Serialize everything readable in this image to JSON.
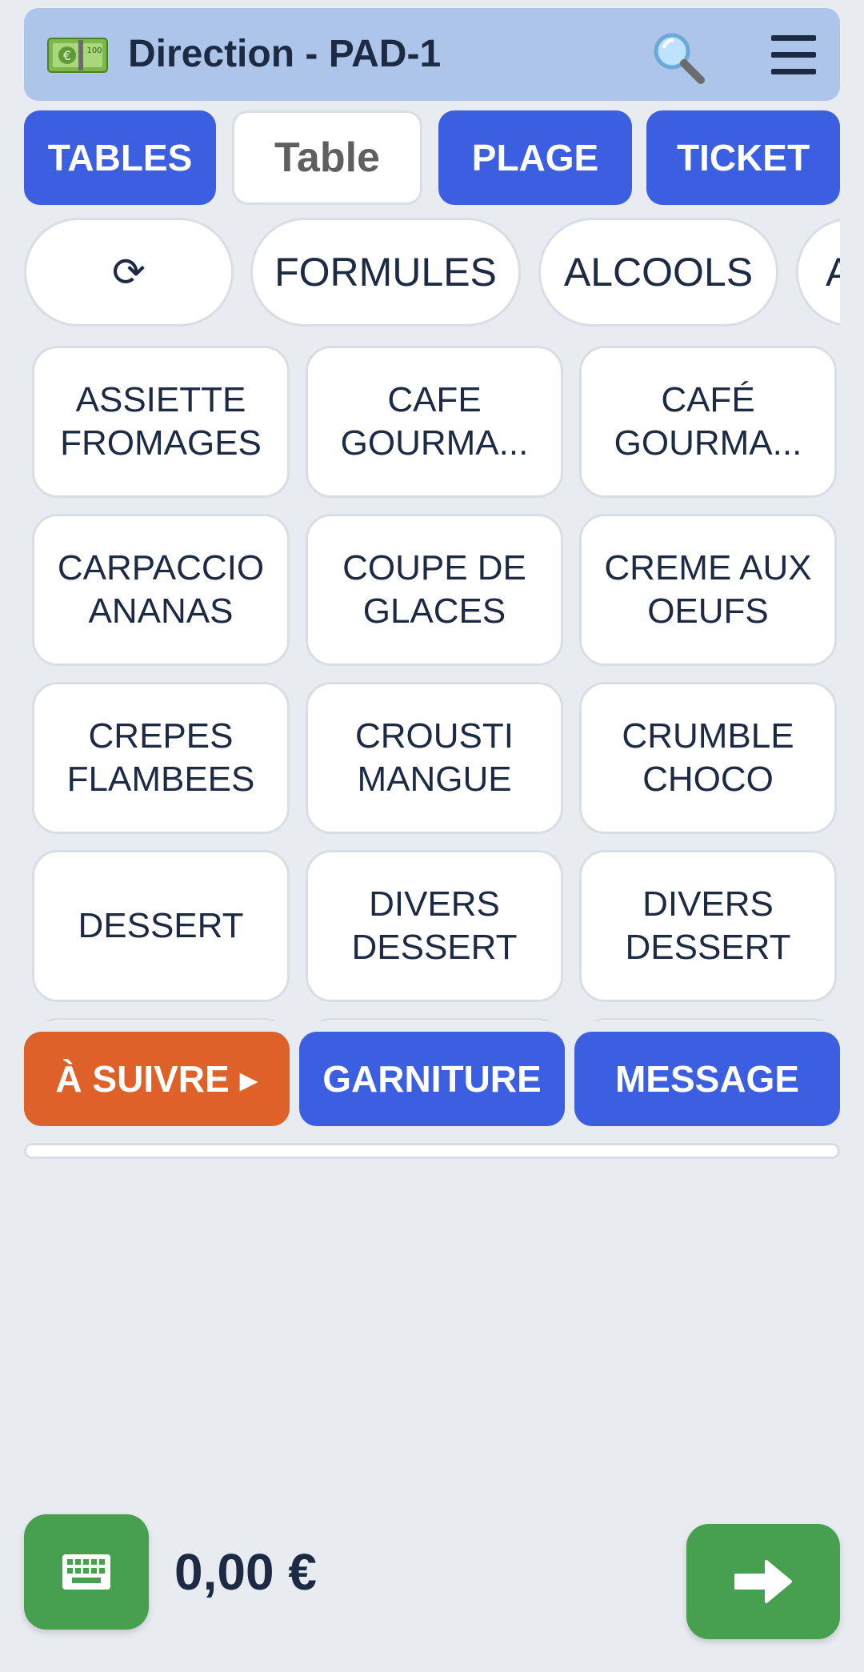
{
  "header": {
    "title": "Direction - PAD-1",
    "logo_icon": "money-bill-icon",
    "search_icon": "search-icon",
    "menu_icon": "hamburger-menu-icon"
  },
  "nav": {
    "tables": "TABLES",
    "table": "Table",
    "plage": "PLAGE",
    "ticket": "TICKET"
  },
  "categories": {
    "refresh_icon": "refresh-icon",
    "items": [
      "⟳",
      "FORMULES",
      "ALCOOLS",
      "A"
    ]
  },
  "products": [
    [
      "ASSIETTE",
      "FROMAGES"
    ],
    [
      "CAFE",
      "GOURMA..."
    ],
    [
      "CAFÉ",
      "GOURMA..."
    ],
    [
      "CARPACCIO",
      "ANANAS"
    ],
    [
      "COUPE DE",
      "GLACES"
    ],
    [
      "CREME AUX",
      "OEUFS"
    ],
    [
      "CREPES",
      "FLAMBEES"
    ],
    [
      "CROUSTI",
      "MANGUE"
    ],
    [
      "CRUMBLE",
      "CHOCO"
    ],
    [
      "DESSERT"
    ],
    [
      "DIVERS",
      "DESSERT"
    ],
    [
      "DIVERS",
      "DESSERT"
    ]
  ],
  "actions": {
    "a_suivre": "À SUIVRE ▸",
    "garniture": "GARNITURE",
    "message": "MESSAGE"
  },
  "footer": {
    "total": "0,00 €",
    "keyboard_icon": "keyboard-icon",
    "next_icon": "arrow-right-icon"
  },
  "colors": {
    "header_bg": "#aec5ea",
    "primary_blue": "#3b5fe0",
    "orange": "#dd6128",
    "green": "#47a04f",
    "background": "#e8ebf0"
  }
}
